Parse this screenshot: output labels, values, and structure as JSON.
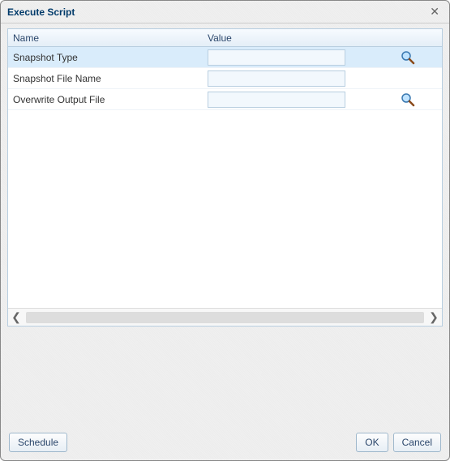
{
  "dialog": {
    "title": "Execute Script"
  },
  "grid": {
    "headers": {
      "name": "Name",
      "value": "Value"
    },
    "rows": [
      {
        "name": "Snapshot Type",
        "value": "",
        "has_lookup": true,
        "selected": true
      },
      {
        "name": "Snapshot File Name",
        "value": "",
        "has_lookup": false,
        "selected": false
      },
      {
        "name": "Overwrite Output File",
        "value": "",
        "has_lookup": true,
        "selected": false
      }
    ]
  },
  "buttons": {
    "schedule": "Schedule",
    "ok": "OK",
    "cancel": "Cancel"
  },
  "icons": {
    "close": "✕",
    "scroll_left": "❮",
    "scroll_right": "❯"
  }
}
